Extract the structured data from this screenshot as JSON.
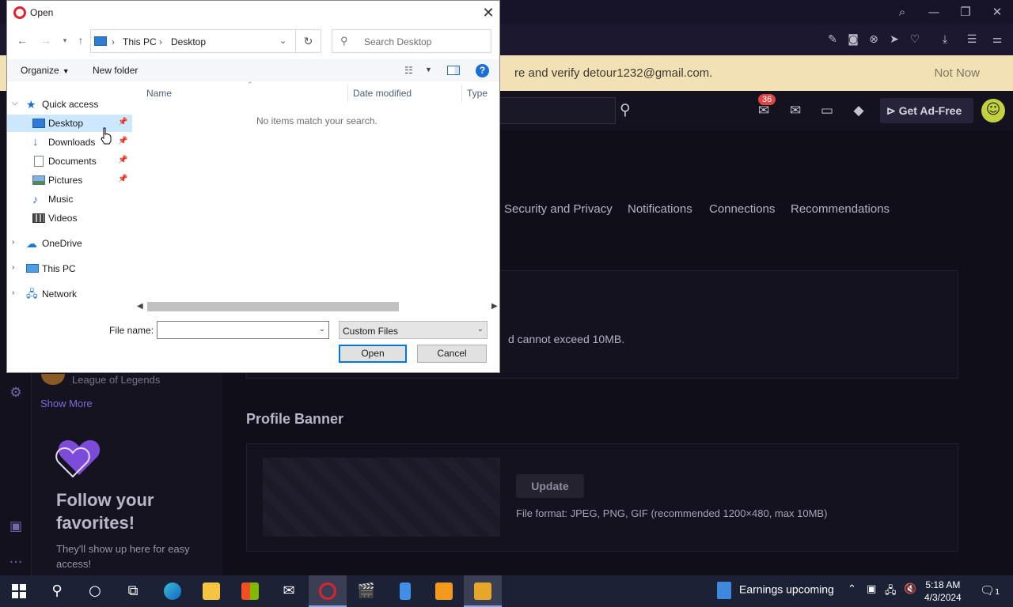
{
  "browser": {
    "verify_message": "re and verify detour1232@gmail.com.",
    "not_now": "Not Now",
    "notification_count": "36",
    "get_ad_free": "Get Ad-Free"
  },
  "site": {
    "tabs": [
      "Security and Privacy",
      "Notifications",
      "Connections",
      "Recommendations"
    ],
    "upload_limit_text": "d cannot exceed 10MB.",
    "profile_banner_title": "Profile Banner",
    "update_button": "Update",
    "banner_format": "File format: JPEG, PNG, GIF (recommended 1200×480, max 10MB)",
    "sidebar_game": "League of Legends",
    "show_more": "Show More",
    "follow_title": "Follow your favorites!",
    "follow_sub": "They'll show up here for easy access!"
  },
  "dialog": {
    "title": "Open",
    "breadcrumb": [
      "This PC",
      "Desktop"
    ],
    "search_placeholder": "Search Desktop",
    "organize": "Organize",
    "new_folder": "New folder",
    "nav": {
      "quick_access": "Quick access",
      "quick_items": [
        "Desktop",
        "Downloads",
        "Documents",
        "Pictures",
        "Music",
        "Videos"
      ],
      "onedrive": "OneDrive",
      "this_pc": "This PC",
      "network": "Network"
    },
    "columns": [
      "Name",
      "Date modified",
      "Type"
    ],
    "empty_message": "No items match your search.",
    "file_name_label": "File name:",
    "file_name_value": "",
    "filter_value": "Custom Files",
    "open_button": "Open",
    "cancel_button": "Cancel"
  },
  "taskbar": {
    "weather_text": "Earnings upcoming",
    "time": "5:18 AM",
    "date": "4/3/2024",
    "notification_count": "1"
  },
  "colors": {
    "accent": "#0078d7",
    "selection": "#cce8ff",
    "banner_bg": "#f3e1b6",
    "avatar": "#c3d140"
  }
}
